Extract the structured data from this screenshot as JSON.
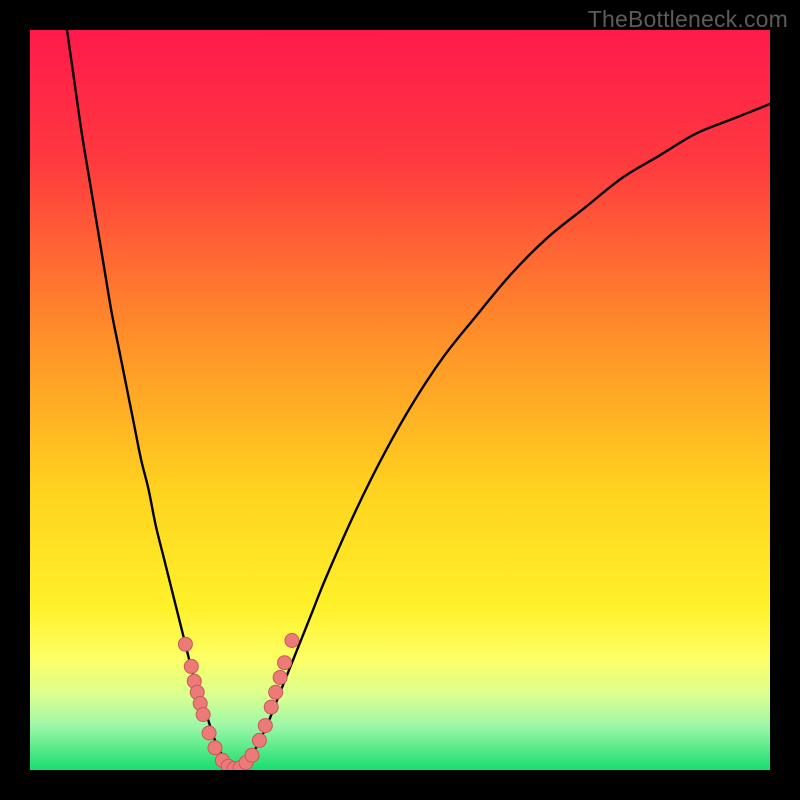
{
  "watermark": "TheBottleneck.com",
  "chart_data": {
    "type": "line",
    "title": "",
    "xlabel": "",
    "ylabel": "",
    "xlim": [
      0,
      100
    ],
    "ylim": [
      0,
      100
    ],
    "gradient_stops": [
      {
        "pct": 0,
        "color": "#ff1a4b"
      },
      {
        "pct": 18,
        "color": "#ff3a3f"
      },
      {
        "pct": 40,
        "color": "#ff8a2a"
      },
      {
        "pct": 62,
        "color": "#ffd21f"
      },
      {
        "pct": 78,
        "color": "#fff12a"
      },
      {
        "pct": 85,
        "color": "#fdff66"
      },
      {
        "pct": 90,
        "color": "#d9ff91"
      },
      {
        "pct": 94,
        "color": "#9ef7a8"
      },
      {
        "pct": 100,
        "color": "#17de6e"
      }
    ],
    "series": [
      {
        "name": "bottleneck-curve",
        "x": [
          5,
          6,
          7,
          8,
          9,
          10,
          11,
          12,
          13,
          14,
          15,
          16,
          17,
          18,
          19,
          20,
          21,
          22,
          23,
          24,
          25,
          26,
          27,
          28,
          29,
          30,
          32,
          34,
          36,
          38,
          40,
          44,
          48,
          52,
          56,
          60,
          65,
          70,
          75,
          80,
          85,
          90,
          95,
          100
        ],
        "y": [
          100,
          93,
          86,
          80,
          74,
          68,
          62,
          57,
          52,
          47,
          42,
          38,
          33,
          29,
          25,
          21,
          17,
          13,
          10,
          7,
          4,
          2,
          1,
          0,
          0.5,
          2,
          6,
          11,
          16,
          21,
          26,
          35,
          43,
          50,
          56,
          61,
          67,
          72,
          76,
          80,
          83,
          86,
          88,
          90
        ]
      }
    ],
    "markers": [
      {
        "x": 21.0,
        "y": 17.0
      },
      {
        "x": 21.8,
        "y": 14.0
      },
      {
        "x": 22.2,
        "y": 12.0
      },
      {
        "x": 22.6,
        "y": 10.5
      },
      {
        "x": 23.0,
        "y": 9.0
      },
      {
        "x": 23.4,
        "y": 7.5
      },
      {
        "x": 24.2,
        "y": 5.0
      },
      {
        "x": 25.0,
        "y": 3.0
      },
      {
        "x": 26.0,
        "y": 1.3
      },
      {
        "x": 26.8,
        "y": 0.5
      },
      {
        "x": 27.6,
        "y": 0.2
      },
      {
        "x": 28.4,
        "y": 0.3
      },
      {
        "x": 29.2,
        "y": 1.0
      },
      {
        "x": 30.0,
        "y": 2.0
      },
      {
        "x": 31.0,
        "y": 4.0
      },
      {
        "x": 31.8,
        "y": 6.0
      },
      {
        "x": 32.6,
        "y": 8.5
      },
      {
        "x": 33.2,
        "y": 10.5
      },
      {
        "x": 33.8,
        "y": 12.5
      },
      {
        "x": 34.4,
        "y": 14.5
      },
      {
        "x": 35.4,
        "y": 17.5
      }
    ],
    "marker_style": {
      "color_fill": "#ec7a78",
      "color_stroke": "#c65a58",
      "radius_px": 7
    }
  }
}
